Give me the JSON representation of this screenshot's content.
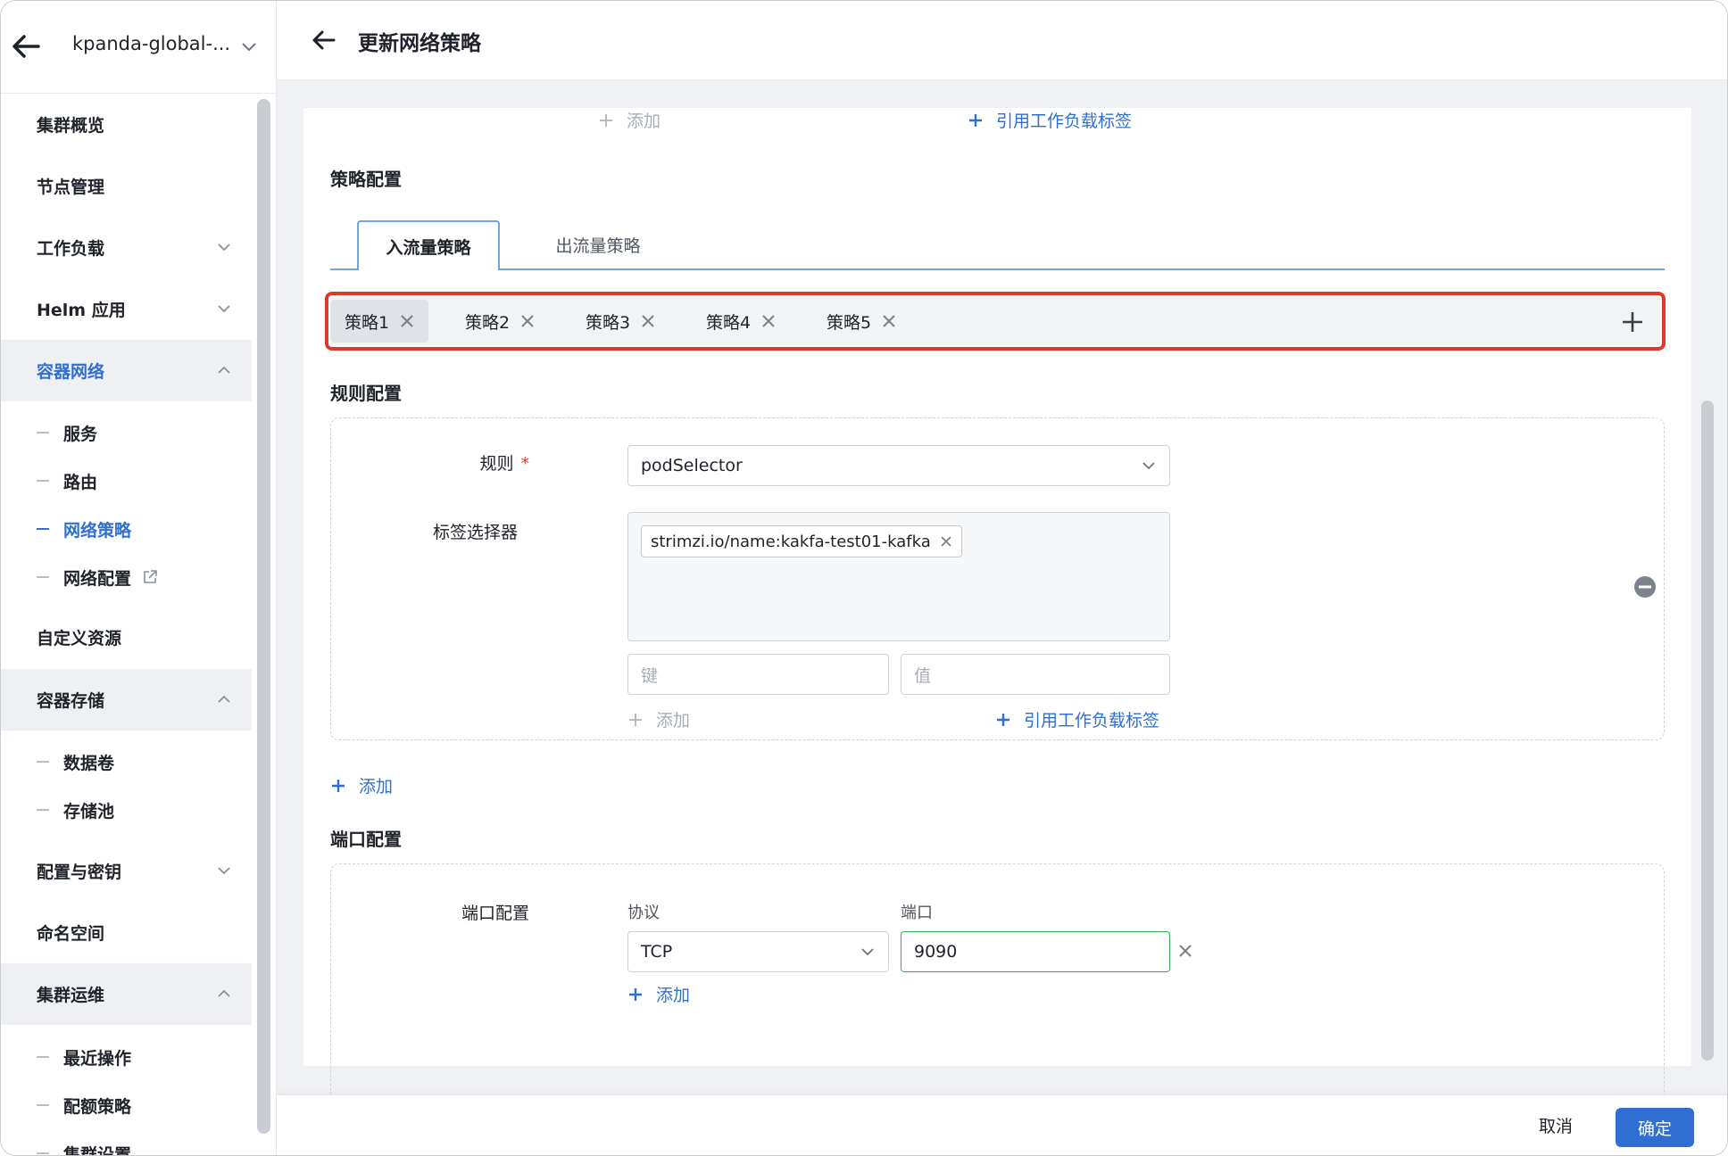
{
  "sidebar": {
    "cluster_name": "kpanda-global-...",
    "items": [
      {
        "label": "集群概览"
      },
      {
        "label": "节点管理"
      },
      {
        "label": "工作负载"
      },
      {
        "label": "Helm 应用"
      },
      {
        "label": "容器网络"
      },
      {
        "label": "服务"
      },
      {
        "label": "路由"
      },
      {
        "label": "网络策略"
      },
      {
        "label": "网络配置"
      },
      {
        "label": "自定义资源"
      },
      {
        "label": "容器存储"
      },
      {
        "label": "数据卷"
      },
      {
        "label": "存储池"
      },
      {
        "label": "配置与密钥"
      },
      {
        "label": "命名空间"
      },
      {
        "label": "集群运维"
      },
      {
        "label": "最近操作"
      },
      {
        "label": "配额策略"
      },
      {
        "label": "集群设置"
      }
    ]
  },
  "header": {
    "title": "更新网络策略"
  },
  "top_row": {
    "add_label": "添加",
    "ref_label": "引用工作负载标签"
  },
  "policy_config": {
    "title": "策略配置",
    "tabs": [
      "入流量策略",
      "出流量策略"
    ],
    "chips": [
      "策略1",
      "策略2",
      "策略3",
      "策略4",
      "策略5"
    ]
  },
  "rule_config": {
    "title": "规则配置",
    "rule_label": "规则",
    "rule_value": "podSelector",
    "selector_label": "标签选择器",
    "tag": "strimzi.io/name:kakfa-test01-kafka",
    "key_placeholder": "键",
    "value_placeholder": "值",
    "add_label": "添加",
    "ref_label": "引用工作负载标签",
    "add_rule_label": "添加"
  },
  "port_config": {
    "title": "端口配置",
    "row_label": "端口配置",
    "protocol_head": "协议",
    "port_head": "端口",
    "protocol_value": "TCP",
    "port_value": "9090",
    "add_label": "添加"
  },
  "footer": {
    "cancel": "取消",
    "confirm": "确定"
  },
  "colors": {
    "accent": "#2f6fd1",
    "highlight": "#e0392b",
    "success": "#34b35a"
  }
}
